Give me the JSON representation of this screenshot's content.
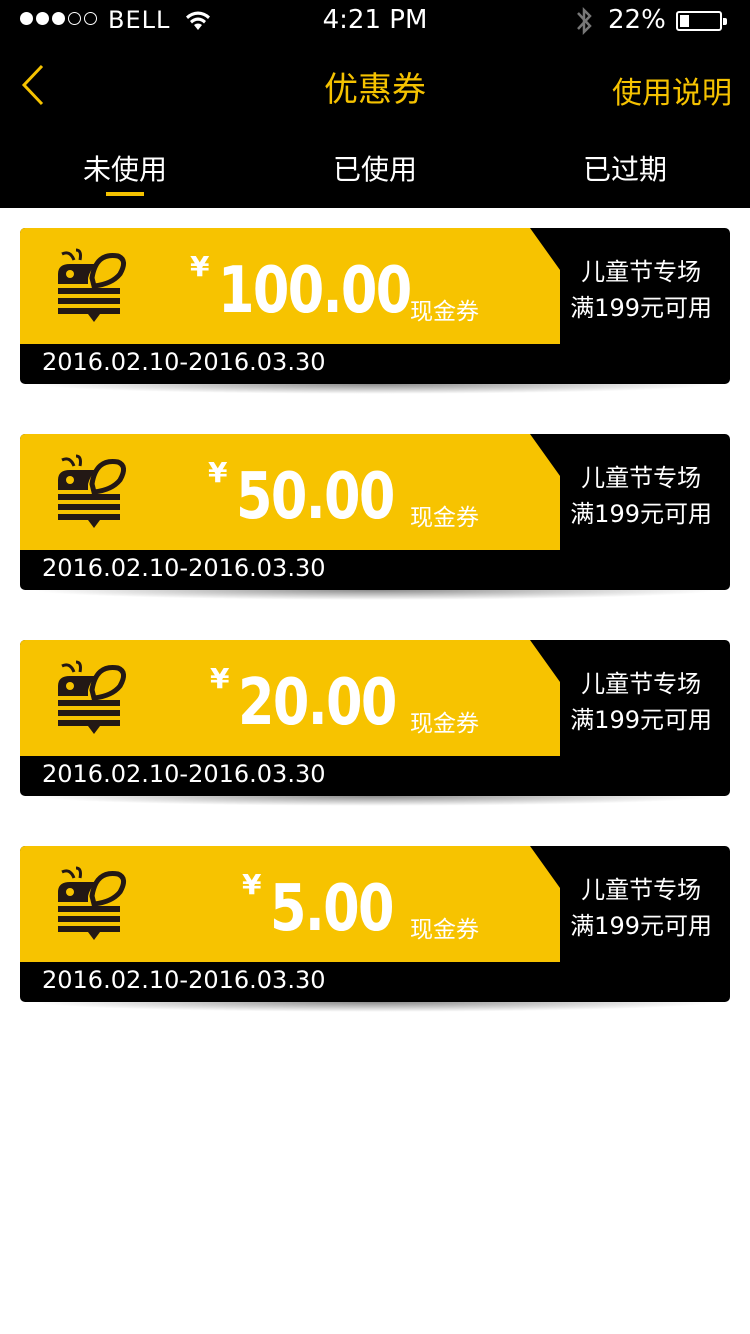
{
  "status_bar": {
    "carrier": "BELL",
    "time": "4:21 PM",
    "battery": "22%"
  },
  "nav": {
    "title": "优惠券",
    "help": "使用说明"
  },
  "tabs": [
    {
      "label": "未使用",
      "active": true
    },
    {
      "label": "已使用",
      "active": false
    },
    {
      "label": "已过期",
      "active": false
    }
  ],
  "coupons": [
    {
      "currency": "¥",
      "amount": "100.00",
      "type": "现金券",
      "validity": "2016.02.10-2016.03.30",
      "event": "儿童节专场",
      "condition": "满199元可用"
    },
    {
      "currency": "¥",
      "amount": "50.00",
      "type": "现金券",
      "validity": "2016.02.10-2016.03.30",
      "event": "儿童节专场",
      "condition": "满199元可用"
    },
    {
      "currency": "¥",
      "amount": "20.00",
      "type": "现金券",
      "validity": "2016.02.10-2016.03.30",
      "event": "儿童节专场",
      "condition": "满199元可用"
    },
    {
      "currency": "¥",
      "amount": "5.00",
      "type": "现金券",
      "validity": "2016.02.10-2016.03.30",
      "event": "儿童节专场",
      "condition": "满199元可用"
    }
  ],
  "colors": {
    "accent": "#f5c200",
    "coupon_yellow": "#f7c300",
    "header_bg": "#000000"
  },
  "icons": [
    "back-chevron-icon",
    "wifi-icon",
    "bluetooth-icon",
    "battery-icon",
    "bee-logo-icon"
  ]
}
